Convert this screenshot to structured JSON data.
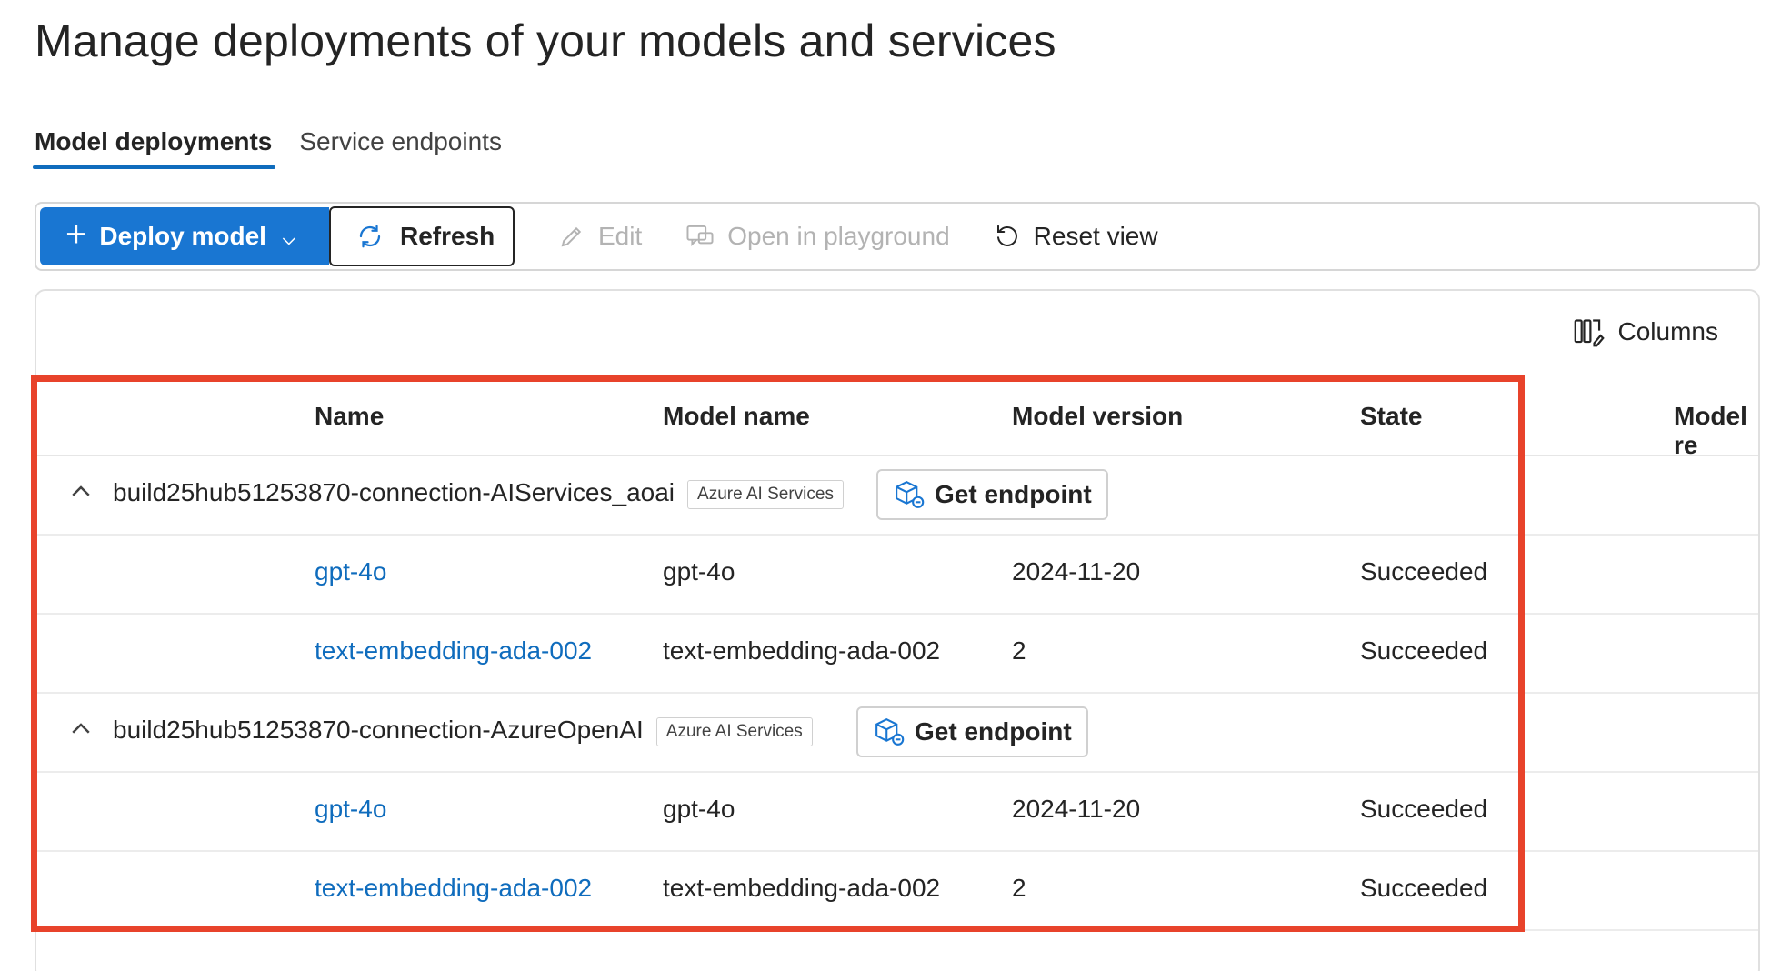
{
  "page_title": "Manage deployments of your models and services",
  "tabs": [
    {
      "label": "Model deployments",
      "active": true
    },
    {
      "label": "Service endpoints",
      "active": false
    }
  ],
  "toolbar": {
    "deploy_label": "Deploy model",
    "refresh_label": "Refresh",
    "edit_label": "Edit",
    "playground_label": "Open in playground",
    "reset_label": "Reset view"
  },
  "columns_label": "Columns",
  "table": {
    "headers": [
      "Name",
      "Model name",
      "Model version",
      "State",
      "Model re"
    ],
    "groups": [
      {
        "name": "build25hub51253870-connection-AIServices_aoai",
        "badge": "Azure AI Services",
        "endpoint_label": "Get endpoint",
        "rows": [
          {
            "name": "gpt-4o",
            "model_name": "gpt-4o",
            "model_version": "2024-11-20",
            "state": "Succeeded"
          },
          {
            "name": "text-embedding-ada-002",
            "model_name": "text-embedding-ada-002",
            "model_version": "2",
            "state": "Succeeded"
          }
        ]
      },
      {
        "name": "build25hub51253870-connection-AzureOpenAI",
        "badge": "Azure AI Services",
        "endpoint_label": "Get endpoint",
        "rows": [
          {
            "name": "gpt-4o",
            "model_name": "gpt-4o",
            "model_version": "2024-11-20",
            "state": "Succeeded"
          },
          {
            "name": "text-embedding-ada-002",
            "model_name": "text-embedding-ada-002",
            "model_version": "2",
            "state": "Succeeded"
          }
        ]
      }
    ]
  },
  "colors": {
    "accent": "#0f6cbd",
    "primary_button": "#1976d2",
    "highlight": "#e8432b"
  }
}
